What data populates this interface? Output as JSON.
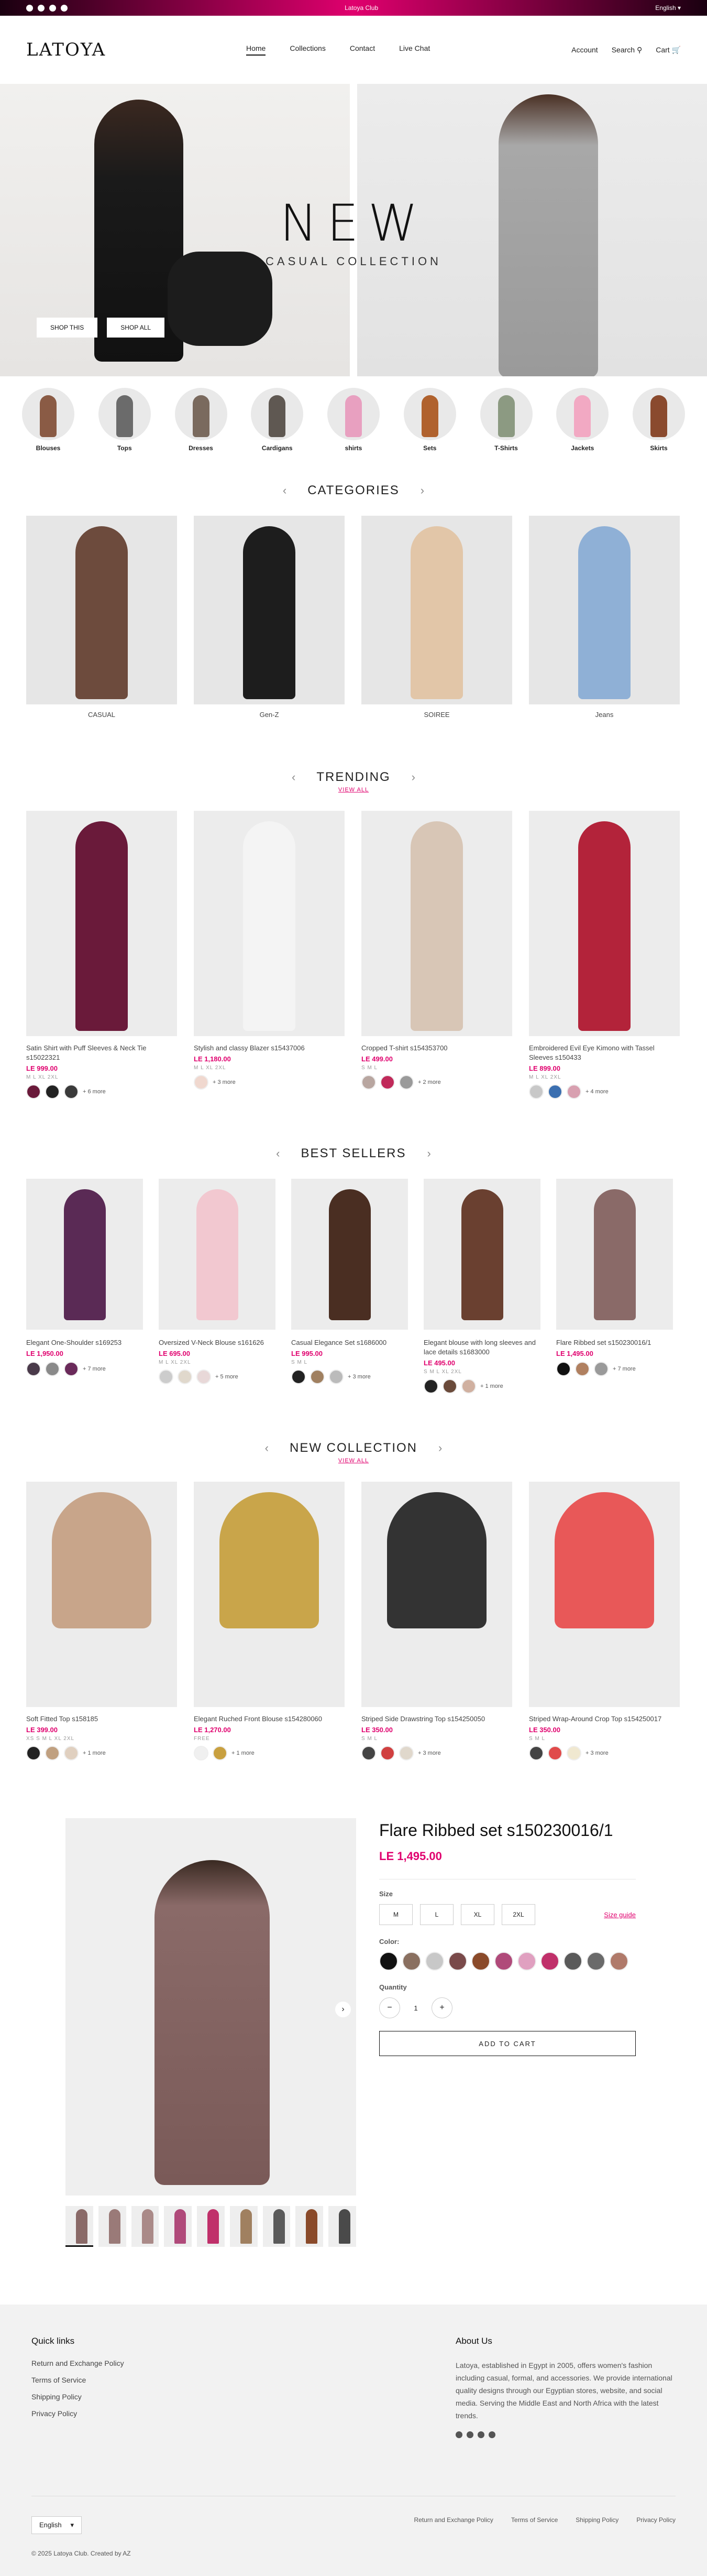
{
  "announcement": {
    "text": "Latoya Club",
    "language": "English"
  },
  "header": {
    "logo": "LATOYA",
    "nav": [
      "Home",
      "Collections",
      "Contact",
      "Live Chat"
    ],
    "account": "Account",
    "search": "Search",
    "cart": "Cart"
  },
  "hero": {
    "title": "NEW",
    "subtitle": "CASUAL COLLECTION",
    "btn1": "SHOP THIS",
    "btn2": "SHOP ALL"
  },
  "circles": [
    {
      "label": "Blouses",
      "color": "#8a5b45"
    },
    {
      "label": "Tops",
      "color": "#6b6b6b"
    },
    {
      "label": "Dresses",
      "color": "#7a6a5e"
    },
    {
      "label": "Cardigans",
      "color": "#5f5852"
    },
    {
      "label": "shirts",
      "color": "#e8a0c0"
    },
    {
      "label": "Sets",
      "color": "#b0622e"
    },
    {
      "label": "T-Shirts",
      "color": "#8c9a82"
    },
    {
      "label": "Jackets",
      "color": "#f2a9c3"
    },
    {
      "label": "Skirts",
      "color": "#8a4a2e"
    }
  ],
  "categories": {
    "title": "CATEGORIES",
    "items": [
      {
        "name": "CASUAL",
        "color": "#6d4b3d"
      },
      {
        "name": "Gen-Z",
        "color": "#1d1d1d"
      },
      {
        "name": "SOIREE",
        "color": "#e2c6a8"
      },
      {
        "name": "Jeans",
        "color": "#8fb0d6"
      }
    ]
  },
  "trending": {
    "title": "TRENDING",
    "view_all": "VIEW ALL",
    "items": [
      {
        "title": "Satin Shirt with Puff Sleeves & Neck Tie s15022321",
        "price": "LE 999.00",
        "sizes": "M L XL 2XL",
        "swatches": [
          "#6a1a3a",
          "#222222",
          "#3a3a3a"
        ],
        "more": "+ 6 more",
        "color": "#6a1a3a"
      },
      {
        "title": "Stylish and classy Blazer s15437006",
        "price": "LE 1,180.00",
        "sizes": "M L XL 2XL",
        "swatches": [
          "#f0d8cf"
        ],
        "more": "+ 3 more",
        "color": "#f4f4f4"
      },
      {
        "title": "Cropped T-shirt s154353700",
        "price": "LE 499.00",
        "sizes": "S M L",
        "swatches": [
          "#b8a6a0",
          "#c02a5a",
          "#9a9a9a"
        ],
        "more": "+ 2 more",
        "color": "#d8c6b6"
      },
      {
        "title": "Embroidered Evil Eye Kimono with Tassel Sleeves s150433",
        "price": "LE 899.00",
        "sizes": "M L XL 2XL",
        "swatches": [
          "#c8c8c8",
          "#3b6fb0",
          "#d8a0b0"
        ],
        "more": "+ 4 more",
        "color": "#b3233a"
      }
    ]
  },
  "best_sellers": {
    "title": "BEST SELLERS",
    "items": [
      {
        "title": "Elegant One-Shoulder s169253",
        "price": "LE 1,950.00",
        "sizes": "",
        "swatches": [
          "#4a3a4a",
          "#8a8a8a",
          "#6a2a5a"
        ],
        "more": "+ 7 more",
        "color": "#5a2a55"
      },
      {
        "title": "Oversized V-Neck Blouse s161626",
        "price": "LE 695.00",
        "sizes": "M L XL 2XL",
        "swatches": [
          "#cccccc",
          "#e0d8cc",
          "#e8d8d8"
        ],
        "more": "+ 5 more",
        "color": "#f2c8d0"
      },
      {
        "title": "Casual Elegance Set s1686000",
        "price": "LE 995.00",
        "sizes": "S M L",
        "swatches": [
          "#222222",
          "#a08060",
          "#bbbbbb"
        ],
        "more": "+ 3 more",
        "color": "#4a2e22"
      },
      {
        "title": "Elegant blouse with long sleeves and lace details s1683000",
        "price": "LE 495.00",
        "sizes": "S M L XL 2XL",
        "swatches": [
          "#222222",
          "#6a4a3a",
          "#d0b0a0"
        ],
        "more": "+ 1 more",
        "color": "#6a4030"
      },
      {
        "title": "Flare Ribbed set s150230016/1",
        "price": "LE 1,495.00",
        "sizes": "",
        "swatches": [
          "#111111",
          "#b08060",
          "#9a9a9a"
        ],
        "more": "+ 7 more",
        "color": "#8a6a68"
      }
    ]
  },
  "new_collection": {
    "title": "NEW COLLECTION",
    "view_all": "VIEW ALL",
    "items": [
      {
        "title": "Soft Fitted Top s158185",
        "price": "LE 399.00",
        "sizes": "XS S M L XL 2XL",
        "swatches": [
          "#222222",
          "#c0a080",
          "#e0d0c0"
        ],
        "more": "+ 1 more",
        "color": "#c8a58a"
      },
      {
        "title": "Elegant Ruched Front Blouse s154280060",
        "price": "LE 1,270.00",
        "sizes": "FREE",
        "swatches": [
          "#f0f0f0",
          "#c8a040"
        ],
        "more": "+ 1 more",
        "color": "#c9a54a"
      },
      {
        "title": "Striped Side Drawstring Top s154250050",
        "price": "LE 350.00",
        "sizes": "S M L",
        "swatches": [
          "#444444",
          "#d04040",
          "#e0d8cc"
        ],
        "more": "+ 3 more",
        "color": "#333333"
      },
      {
        "title": "Striped Wrap-Around Crop Top s154250017",
        "price": "LE 350.00",
        "sizes": "S M L",
        "swatches": [
          "#444444",
          "#e04a4a",
          "#f0e8d0"
        ],
        "more": "+ 3 more",
        "color": "#e85858"
      }
    ]
  },
  "featured": {
    "title": "Flare Ribbed set s150230016/1",
    "price": "LE 1,495.00",
    "size_label": "Size",
    "sizes": [
      "M",
      "L",
      "XL",
      "2XL"
    ],
    "size_guide": "Size guide",
    "color_label": "Color:",
    "colors": [
      "#111111",
      "#8a7060",
      "#c8c8c8",
      "#7a4a4a",
      "#8a4a2a",
      "#b04a7a",
      "#e0a0c0",
      "#c0306a",
      "#5a5a5a",
      "#6a6a6a",
      "#b07a6a"
    ],
    "qty_label": "Quantity",
    "qty": "1",
    "add_to_cart": "ADD TO CART",
    "thumb_colors": [
      "#8a6a68",
      "#9a7a78",
      "#aa8a88",
      "#b04a7a",
      "#c0306a",
      "#a08060",
      "#5a5a5a",
      "#8a4a2a",
      "#4a4a4a"
    ]
  },
  "footer": {
    "quick_links_title": "Quick links",
    "quick_links": [
      "Return and Exchange Policy",
      "Terms of Service",
      "Shipping Policy",
      "Privacy Policy"
    ],
    "about_title": "About Us",
    "about_text": "Latoya, established in Egypt in 2005, offers women's fashion including casual, formal, and accessories. We provide international quality designs through our Egyptian stores, website, and social media. Serving the Middle East and North Africa with the latest trends.",
    "language": "English",
    "copyright": "© 2025 Latoya Club. Created by AZ",
    "bottom_links": [
      "Return and Exchange Policy",
      "Terms of Service",
      "Shipping Policy",
      "Privacy Policy"
    ]
  }
}
